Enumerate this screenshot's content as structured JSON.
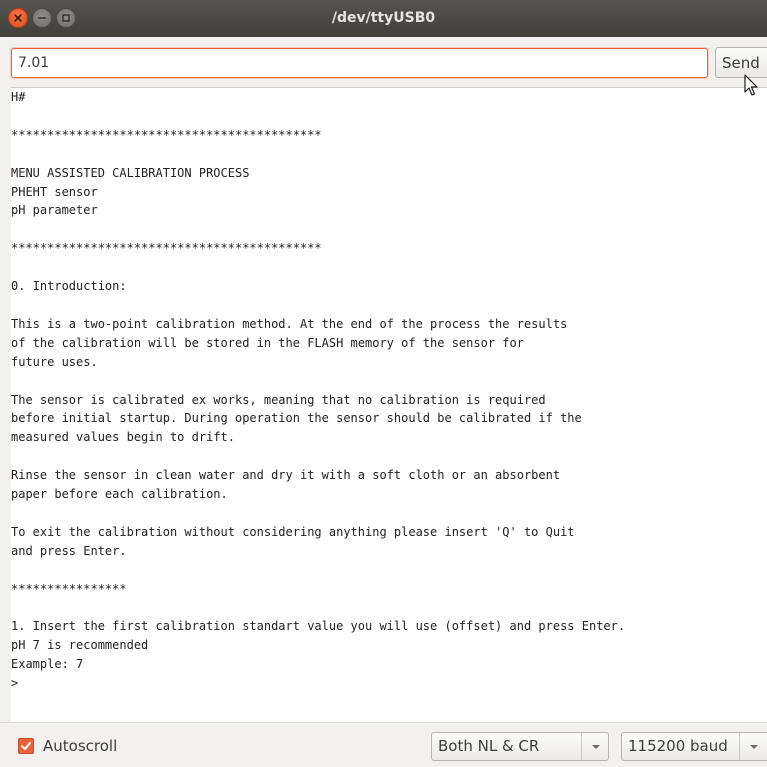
{
  "window": {
    "title": "/dev/ttyUSB0",
    "controls": [
      "close-icon",
      "minimize-icon",
      "maximize-icon"
    ]
  },
  "send_row": {
    "input_value": "7.01",
    "send_label": "Send"
  },
  "output": {
    "text": "H#\n\n*******************************************\n\nMENU ASSISTED CALIBRATION PROCESS\nPHEHT sensor\npH parameter\n\n*******************************************\n\n0. Introduction:\n\nThis is a two-point calibration method. At the end of the process the results\nof the calibration will be stored in the FLASH memory of the sensor for\nfuture uses.\n\nThe sensor is calibrated ex works, meaning that no calibration is required\nbefore initial startup. During operation the sensor should be calibrated if the\nmeasured values begin to drift.\n\nRinse the sensor in clean water and dry it with a soft cloth or an absorbent\npaper before each calibration.\n\nTo exit the calibration without considering anything please insert 'Q' to Quit\nand press Enter.\n\n****************\n\n1. Insert the first calibration standart value you will use (offset) and press Enter.\npH 7 is recommended\nExample: 7\n>"
  },
  "bottom_bar": {
    "autoscroll_label": "Autoscroll",
    "autoscroll_checked": true,
    "line_ending_selected": "Both NL & CR",
    "baud_selected": "115200 baud"
  },
  "colors": {
    "accent": "#e9633a",
    "titlebar": "#403f3b",
    "background": "#f2f1f0"
  }
}
